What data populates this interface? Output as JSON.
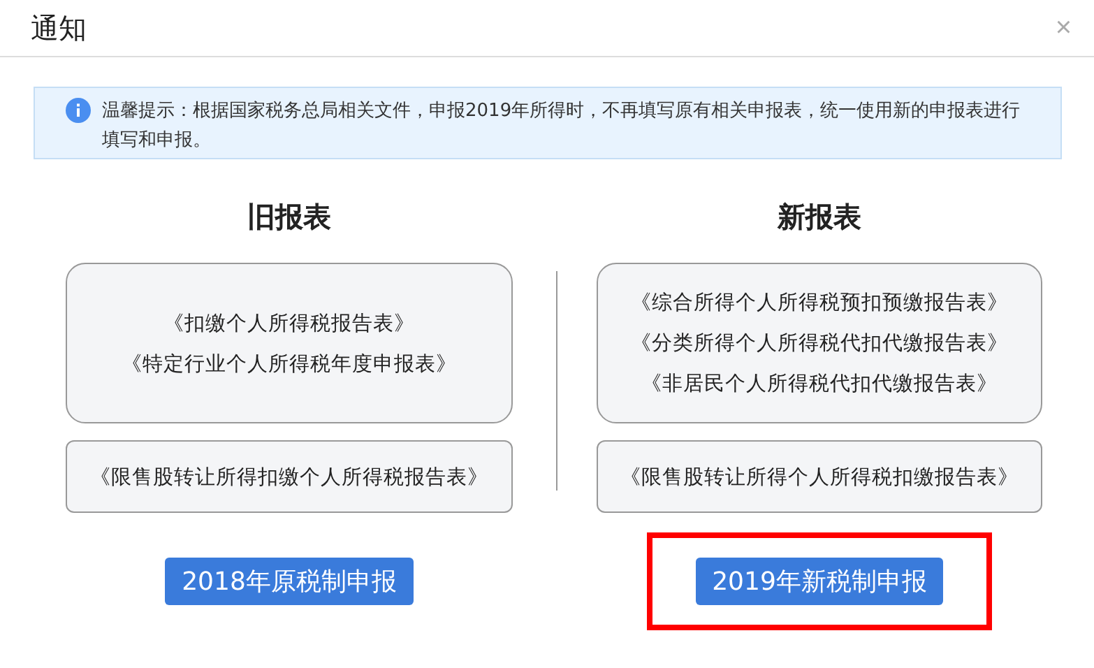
{
  "dialog": {
    "title": "通知",
    "close": "×"
  },
  "notice": {
    "text": "温馨提示：根据国家税务总局相关文件，申报2019年所得时，不再填写原有相关申报表，统一使用新的申报表进行填写和申报。"
  },
  "columns": [
    {
      "heading": "旧报表",
      "groups": [
        [
          "《扣缴个人所得税报告表》",
          "《特定行业个人所得税年度申报表》"
        ],
        [
          "《限售股转让所得扣缴个人所得税报告表》"
        ]
      ],
      "button": {
        "label": "2018年原税制申报",
        "highlighted": false
      }
    },
    {
      "heading": "新报表",
      "groups": [
        [
          "《综合所得个人所得税预扣预缴报告表》",
          "《分类所得个人所得税代扣代缴报告表》",
          "《非居民个人所得税代扣代缴报告表》"
        ],
        [
          "《限售股转让所得个人所得税扣缴报告表》"
        ]
      ],
      "button": {
        "label": "2019年新税制申报",
        "highlighted": true
      }
    }
  ]
}
